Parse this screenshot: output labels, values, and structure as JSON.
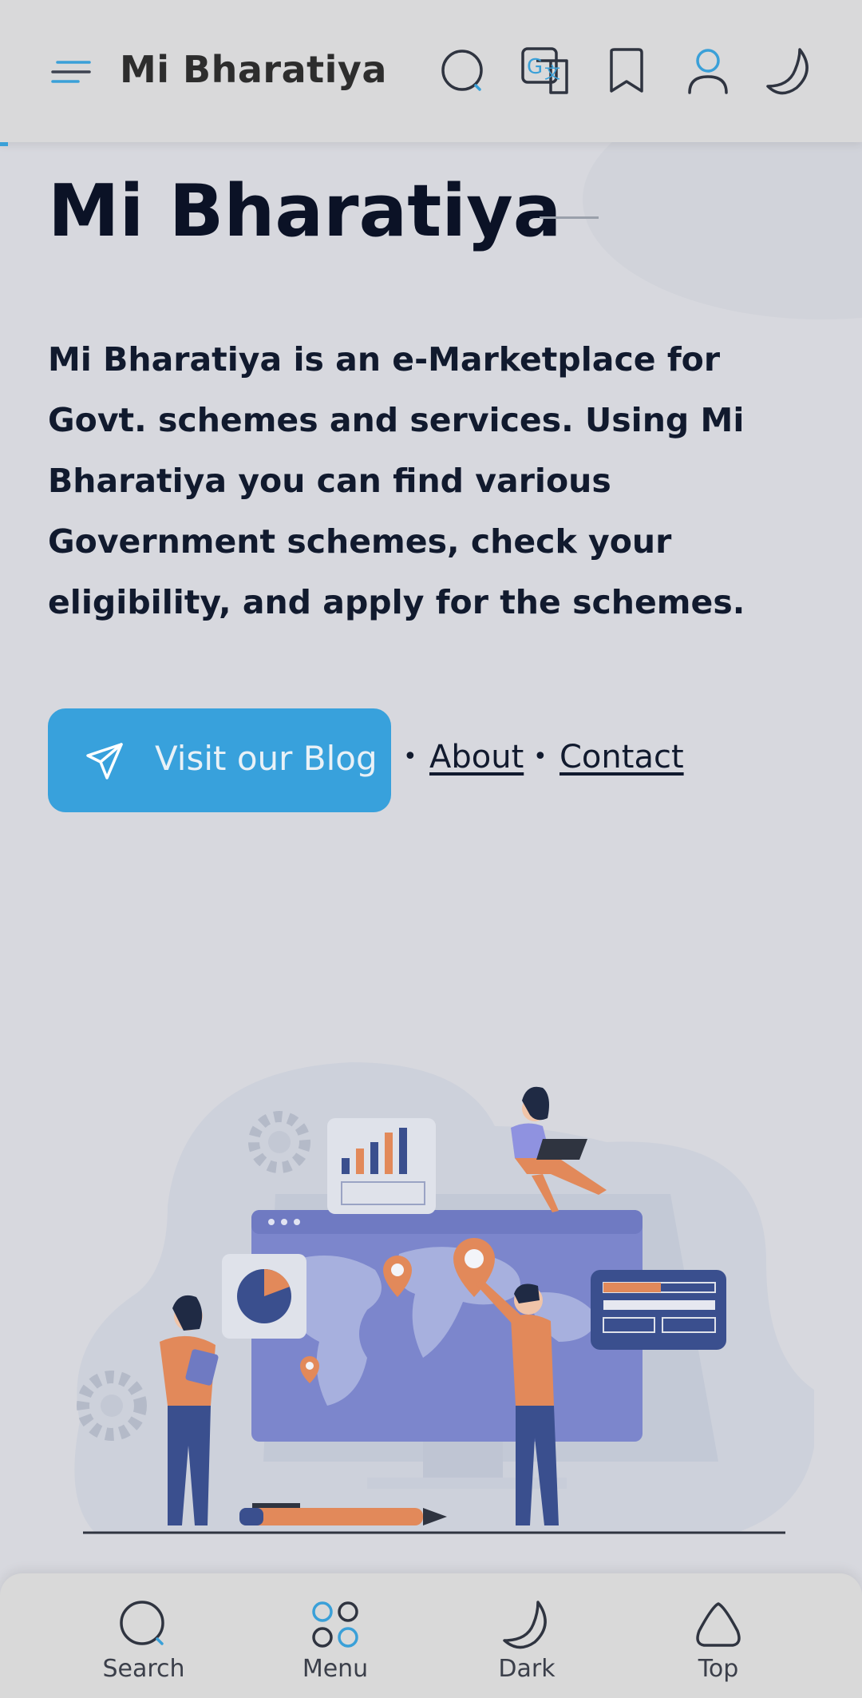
{
  "header": {
    "brand": "Mi Bharatiya"
  },
  "hero": {
    "title": "Mi Bharatiya",
    "description": "Mi Bharatiya is an e-Marketplace for Govt. schemes and services. Using Mi Bharatiya you can find various Government schemes, check your eligibility, and apply for the schemes.",
    "blog_button": "Visit our Blog",
    "separator": "•",
    "links": {
      "about": "About",
      "contact": "Contact"
    }
  },
  "bottom_nav": {
    "items": [
      {
        "label": "Search",
        "icon": "search-icon"
      },
      {
        "label": "Menu",
        "icon": "menu-grid-icon"
      },
      {
        "label": "Dark",
        "icon": "moon-icon"
      },
      {
        "label": "Top",
        "icon": "arrow-top-icon"
      }
    ]
  },
  "colors": {
    "accent": "#38a1dc",
    "page_background": "#d7d8de",
    "text_dark": "#0b1226"
  }
}
